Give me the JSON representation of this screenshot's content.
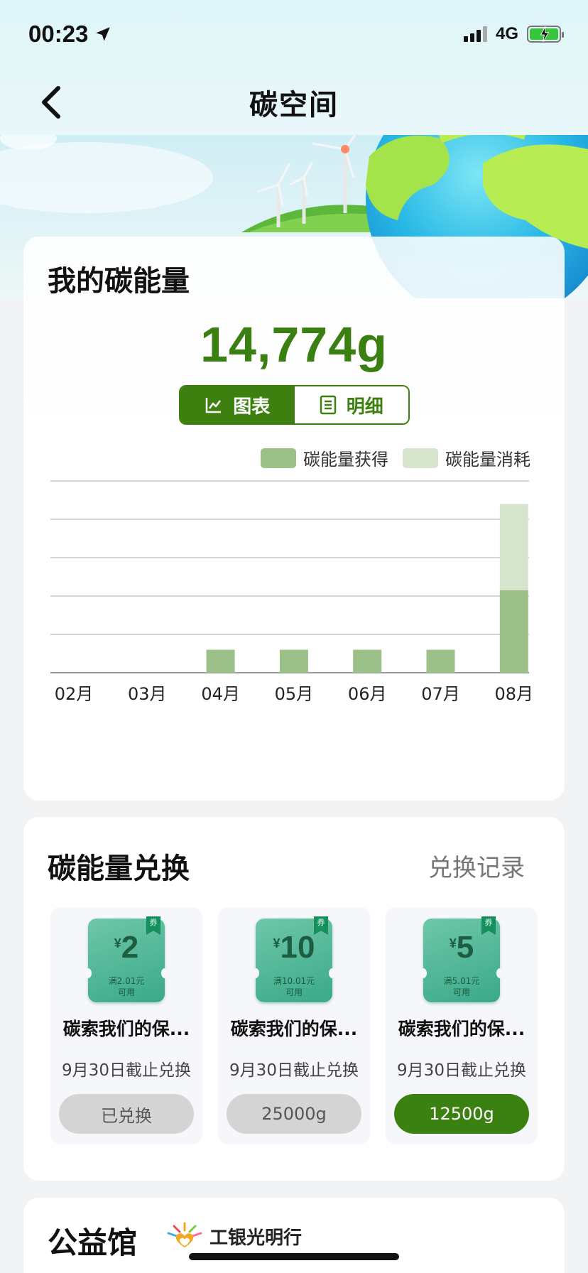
{
  "status": {
    "time": "00:23",
    "network": "4G"
  },
  "nav": {
    "title": "碳空间"
  },
  "energy": {
    "title": "我的碳能量",
    "amount": "14,774g",
    "tabs": [
      "图表",
      "明细"
    ],
    "legend": [
      "碳能量获得",
      "碳能量消耗"
    ]
  },
  "chart_data": {
    "type": "bar",
    "categories": [
      "02月",
      "03月",
      "04月",
      "05月",
      "06月",
      "07月",
      "08月"
    ],
    "series": [
      {
        "name": "碳能量获得",
        "values": [
          0,
          0,
          0.6,
          0.6,
          0.6,
          0.6,
          2.15
        ],
        "color": "#9bc088"
      },
      {
        "name": "碳能量消耗",
        "values": [
          0,
          0,
          0,
          0,
          0,
          0,
          2.25
        ],
        "color": "#d6e4cd"
      }
    ],
    "stacked": true,
    "ylim": [
      0,
      5
    ],
    "grid": true,
    "legend_position": "top-right"
  },
  "exchange": {
    "title": "碳能量兑换",
    "record_link": "兑换记录",
    "coupons": [
      {
        "amount": "2",
        "yen": "¥",
        "condition": "满2.01元",
        "usable": "可用",
        "tag": "券",
        "name": "碳索我们的保...",
        "deadline": "9月30日截止兑换",
        "button": "已兑换",
        "state": "done"
      },
      {
        "amount": "10",
        "yen": "¥",
        "condition": "满10.01元",
        "usable": "可用",
        "tag": "券",
        "name": "碳索我们的保...",
        "deadline": "9月30日截止兑换",
        "button": "25000g",
        "state": "locked"
      },
      {
        "amount": "5",
        "yen": "¥",
        "condition": "满5.01元",
        "usable": "可用",
        "tag": "券",
        "name": "碳索我们的保...",
        "deadline": "9月30日截止兑换",
        "button": "12500g",
        "state": "available"
      }
    ]
  },
  "charity": {
    "title": "公益馆",
    "logo_text": "工银光明行"
  },
  "colors": {
    "brand_green": "#3a8112",
    "amount_green": "#3a7f12",
    "gain": "#9bc088",
    "consume": "#d6e4cd"
  }
}
